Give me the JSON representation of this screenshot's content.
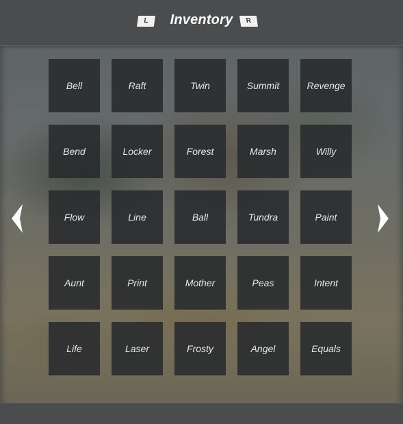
{
  "header": {
    "title": "Inventory",
    "left_shoulder": "L",
    "right_shoulder": "R"
  },
  "navigation": {
    "prev_icon": "chevron-left-icon",
    "next_icon": "chevron-right-icon"
  },
  "inventory": {
    "slots": [
      "Bell",
      "Raft",
      "Twin",
      "Summit",
      "Revenge",
      "Bend",
      "Locker",
      "Forest",
      "Marsh",
      "Willy",
      "Flow",
      "Line",
      "Ball",
      "Tundra",
      "Paint",
      "Aunt",
      "Print",
      "Mother",
      "Peas",
      "Intent",
      "Life",
      "Laser",
      "Frosty",
      "Angel",
      "Equals"
    ]
  },
  "colors": {
    "header_bg": "#4a4c4d",
    "slot_bg": "#2a2c2e",
    "text": "#ffffff"
  }
}
